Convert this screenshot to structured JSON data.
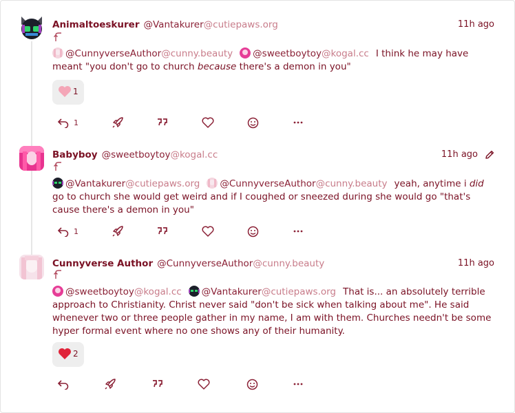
{
  "colors": {
    "accent": "#7a1124",
    "host": "#c87c8a",
    "reaction_bg": "#eeeeee"
  },
  "posts": [
    {
      "author": "Animaltoeskurer",
      "handle_user": "@Vantakurer",
      "handle_host": "@cutiepaws.org",
      "time": "11h ago",
      "reply_icon": "reply-arrow-icon",
      "mentions": [
        {
          "user": "@CunnyverseAuthor",
          "host": "@cunny.beauty"
        },
        {
          "user": "@sweetboytoy",
          "host": "@kogal.cc"
        }
      ],
      "text_a": "I think he may have meant \"you don't go to church ",
      "text_em": "because",
      "text_b": " there's a demon in you\"",
      "reaction": {
        "icon": "heart-icon",
        "count": "1"
      },
      "reply_count": "1"
    },
    {
      "author": "Babyboy",
      "handle_user": "@sweetboytoy",
      "handle_host": "@kogal.cc",
      "time": "11h ago",
      "edited_icon": "pencil-icon",
      "mentions": [
        {
          "user": "@Vantakurer",
          "host": "@cutiepaws.org"
        },
        {
          "user": "@CunnyverseAuthor",
          "host": "@cunny.beauty"
        }
      ],
      "text_a": "yeah, anytime i ",
      "text_em": "did",
      "text_b": " go to church she would get weird and if I coughed or sneezed during she would go \"that's cause there's a demon in you\"",
      "reply_count": "1"
    },
    {
      "author": "Cunnyverse Author",
      "handle_user": "@CunnyverseAuthor",
      "handle_host": "@cunny.beauty",
      "time": "11h ago",
      "mentions": [
        {
          "user": "@sweetboytoy",
          "host": "@kogal.cc"
        },
        {
          "user": "@Vantakurer",
          "host": "@cutiepaws.org"
        }
      ],
      "text_a": "That is... an absolutely terrible approach to Christianity. Christ never said \"don't be sick when talking about me\". He said whenever two or three people gather in my name, I am with them. Churches needn't be some hyper formal event where no one shows any of their humanity.",
      "reaction": {
        "icon": "heart-icon",
        "count": "2"
      }
    }
  ],
  "action_icons": [
    "reply-icon",
    "boost-rocket-icon",
    "quote-icon",
    "favorite-heart-icon",
    "emoji-react-icon",
    "more-icon"
  ]
}
